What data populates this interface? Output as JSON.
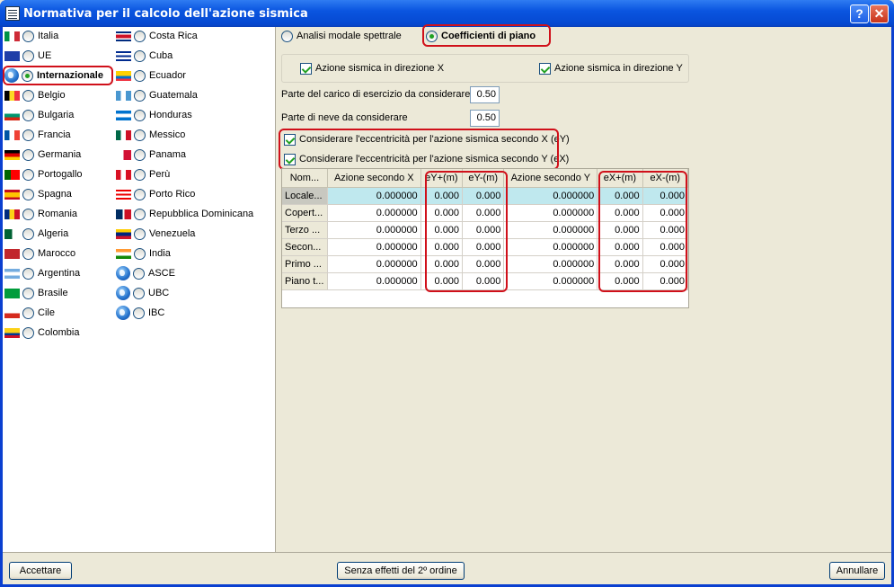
{
  "window": {
    "title": "Normativa per il calcolo dell'azione sismica",
    "help_label": "?",
    "close_label": "✕"
  },
  "countries_col1": [
    {
      "label": "Italia",
      "flag": "italy"
    },
    {
      "label": "UE",
      "flag": "eu"
    },
    {
      "label": "Internazionale",
      "flag": "globe",
      "selected": true
    },
    {
      "label": "Belgio",
      "flag": "belgium"
    },
    {
      "label": "Bulgaria",
      "flag": "bulgaria"
    },
    {
      "label": "Francia",
      "flag": "france"
    },
    {
      "label": "Germania",
      "flag": "germany"
    },
    {
      "label": "Portogallo",
      "flag": "portugal"
    },
    {
      "label": "Spagna",
      "flag": "spain"
    },
    {
      "label": "Romania",
      "flag": "romania"
    },
    {
      "label": "Algeria",
      "flag": "algeria"
    },
    {
      "label": "Marocco",
      "flag": "morocco"
    },
    {
      "label": "Argentina",
      "flag": "argentina"
    },
    {
      "label": "Brasile",
      "flag": "brazil"
    },
    {
      "label": "Cile",
      "flag": "chile"
    },
    {
      "label": "Colombia",
      "flag": "colombia"
    }
  ],
  "countries_col2": [
    {
      "label": "Costa Rica",
      "flag": "costarica"
    },
    {
      "label": "Cuba",
      "flag": "cuba"
    },
    {
      "label": "Ecuador",
      "flag": "ecuador"
    },
    {
      "label": "Guatemala",
      "flag": "guatemala"
    },
    {
      "label": "Honduras",
      "flag": "honduras"
    },
    {
      "label": "Messico",
      "flag": "mexico"
    },
    {
      "label": "Panama",
      "flag": "panama"
    },
    {
      "label": "Perù",
      "flag": "peru"
    },
    {
      "label": "Porto Rico",
      "flag": "puertorico"
    },
    {
      "label": "Repubblica Dominicana",
      "flag": "dominican"
    },
    {
      "label": "Venezuela",
      "flag": "venezuela"
    },
    {
      "label": "India",
      "flag": "india"
    },
    {
      "label": "ASCE",
      "flag": "globe"
    },
    {
      "label": "UBC",
      "flag": "globe"
    },
    {
      "label": "IBC",
      "flag": "globe"
    }
  ],
  "method": {
    "option1": "Analisi modale spettrale",
    "option2": "Coefficienti di piano",
    "selected": "option2"
  },
  "directions": {
    "x_label": "Azione sismica in direzione X",
    "y_label": "Azione sismica in direzione Y",
    "x_checked": true,
    "y_checked": true
  },
  "params": {
    "load_label": "Parte del carico di esercizio da considerare",
    "load_value": "0.50",
    "snow_label": "Parte di neve da considerare",
    "snow_value": "0.50"
  },
  "eccentricity": {
    "x_label": "Considerare l'eccentricità per l'azione sismica secondo X (eY)",
    "y_label": "Considerare l'eccentricità per l'azione sismica secondo Y (eX)",
    "x_checked": true,
    "y_checked": true
  },
  "table": {
    "headers": [
      "Nom...",
      "Azione secondo X",
      "eY+(m)",
      "eY-(m)",
      "Azione secondo Y",
      "eX+(m)",
      "eX-(m)"
    ],
    "rows": [
      [
        "Locale...",
        "0.000000",
        "0.000",
        "0.000",
        "0.000000",
        "0.000",
        "0.000"
      ],
      [
        "Copert...",
        "0.000000",
        "0.000",
        "0.000",
        "0.000000",
        "0.000",
        "0.000"
      ],
      [
        "Terzo ...",
        "0.000000",
        "0.000",
        "0.000",
        "0.000000",
        "0.000",
        "0.000"
      ],
      [
        "Secon...",
        "0.000000",
        "0.000",
        "0.000",
        "0.000000",
        "0.000",
        "0.000"
      ],
      [
        "Primo ...",
        "0.000000",
        "0.000",
        "0.000",
        "0.000000",
        "0.000",
        "0.000"
      ],
      [
        "Piano t...",
        "0.000000",
        "0.000",
        "0.000",
        "0.000000",
        "0.000",
        "0.000"
      ]
    ]
  },
  "buttons": {
    "accept": "Accettare",
    "second_order": "Senza effetti del 2º ordine",
    "cancel": "Annullare"
  },
  "colors": {
    "highlight": "#d0101a",
    "radio_on": "#21a121",
    "title_bar": "#0a55e0",
    "selected_row": "#bfe8ee"
  }
}
